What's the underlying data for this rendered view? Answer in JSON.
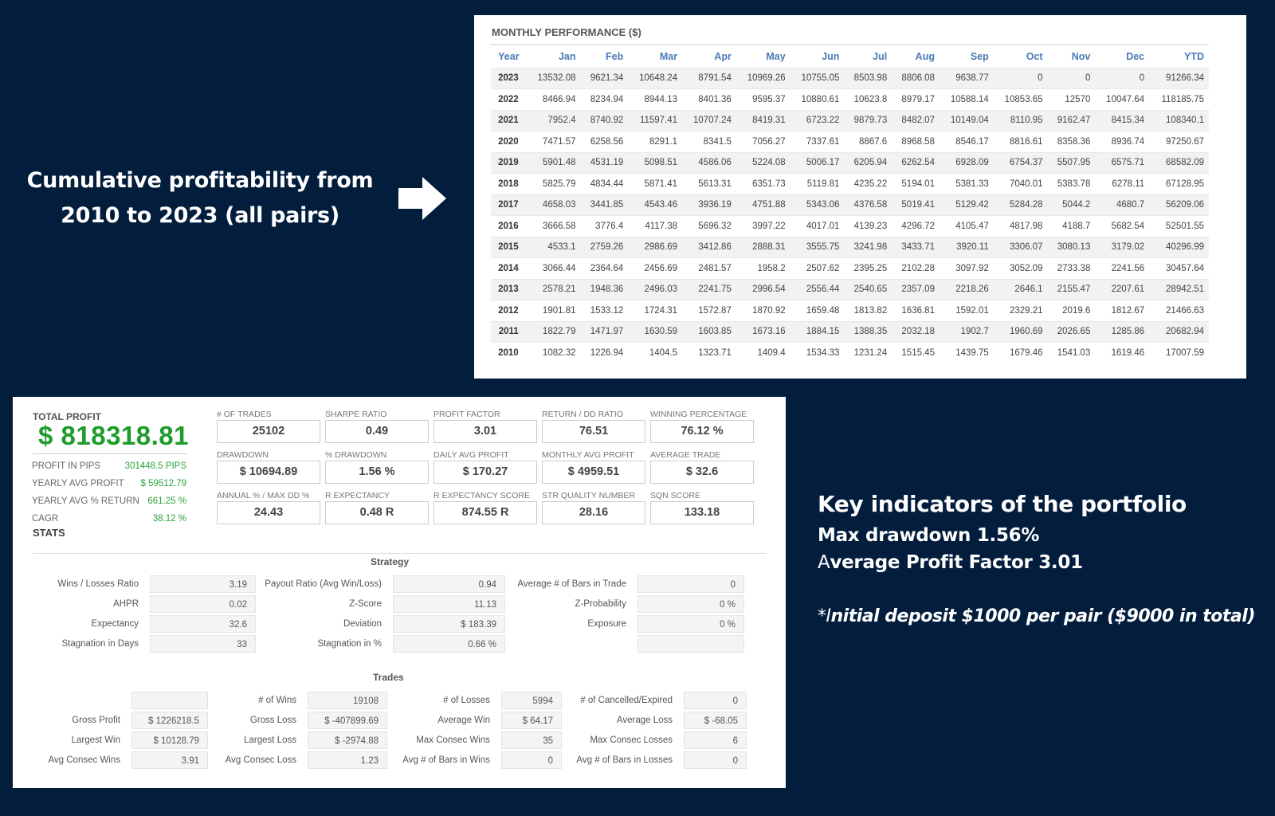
{
  "caption": {
    "line1": "Cumulative profitability from",
    "line2": "2010 to 2023 (all pairs)",
    "arrow_icon": "right-arrow-icon"
  },
  "monthly_performance": {
    "title": "MONTHLY PERFORMANCE ($)",
    "columns": [
      "Year",
      "Jan",
      "Feb",
      "Mar",
      "Apr",
      "May",
      "Jun",
      "Jul",
      "Aug",
      "Sep",
      "Oct",
      "Nov",
      "Dec",
      "YTD"
    ],
    "rows": [
      [
        "2023",
        "13532.08",
        "9621.34",
        "10648.24",
        "8791.54",
        "10969.26",
        "10755.05",
        "8503.98",
        "8806.08",
        "9638.77",
        "0",
        "0",
        "0",
        "91266.34"
      ],
      [
        "2022",
        "8466.94",
        "8234.94",
        "8944.13",
        "8401.36",
        "9595.37",
        "10880.61",
        "10623.8",
        "8979.17",
        "10588.14",
        "10853.65",
        "12570",
        "10047.64",
        "118185.75"
      ],
      [
        "2021",
        "7952.4",
        "8740.92",
        "11597.41",
        "10707.24",
        "8419.31",
        "6723.22",
        "9879.73",
        "8482.07",
        "10149.04",
        "8110.95",
        "9162.47",
        "8415.34",
        "108340.1"
      ],
      [
        "2020",
        "7471.57",
        "6258.56",
        "8291.1",
        "8341.5",
        "7056.27",
        "7337.61",
        "8867.6",
        "8968.58",
        "8546.17",
        "8816.61",
        "8358.36",
        "8936.74",
        "97250.67"
      ],
      [
        "2019",
        "5901.48",
        "4531.19",
        "5098.51",
        "4586.06",
        "5224.08",
        "5006.17",
        "6205.94",
        "6262.54",
        "6928.09",
        "6754.37",
        "5507.95",
        "6575.71",
        "68582.09"
      ],
      [
        "2018",
        "5825.79",
        "4834.44",
        "5871.41",
        "5613.31",
        "6351.73",
        "5119.81",
        "4235.22",
        "5194.01",
        "5381.33",
        "7040.01",
        "5383.78",
        "6278.11",
        "67128.95"
      ],
      [
        "2017",
        "4658.03",
        "3441.85",
        "4543.46",
        "3936.19",
        "4751.88",
        "5343.06",
        "4376.58",
        "5019.41",
        "5129.42",
        "5284.28",
        "5044.2",
        "4680.7",
        "56209.06"
      ],
      [
        "2016",
        "3666.58",
        "3776.4",
        "4117.38",
        "5696.32",
        "3997.22",
        "4017.01",
        "4139.23",
        "4296.72",
        "4105.47",
        "4817.98",
        "4188.7",
        "5682.54",
        "52501.55"
      ],
      [
        "2015",
        "4533.1",
        "2759.26",
        "2986.69",
        "3412.86",
        "2888.31",
        "3555.75",
        "3241.98",
        "3433.71",
        "3920.11",
        "3306.07",
        "3080.13",
        "3179.02",
        "40296.99"
      ],
      [
        "2014",
        "3066.44",
        "2364.64",
        "2456.69",
        "2481.57",
        "1958.2",
        "2507.62",
        "2395.25",
        "2102.28",
        "3097.92",
        "3052.09",
        "2733.38",
        "2241.56",
        "30457.64"
      ],
      [
        "2013",
        "2578.21",
        "1948.36",
        "2496.03",
        "2241.75",
        "2996.54",
        "2556.44",
        "2540.65",
        "2357.09",
        "2218.26",
        "2646.1",
        "2155.47",
        "2207.61",
        "28942.51"
      ],
      [
        "2012",
        "1901.81",
        "1533.12",
        "1724.31",
        "1572.87",
        "1870.92",
        "1659.48",
        "1813.82",
        "1636.81",
        "1592.01",
        "2329.21",
        "2019.6",
        "1812.67",
        "21466.63"
      ],
      [
        "2011",
        "1822.79",
        "1471.97",
        "1630.59",
        "1603.85",
        "1673.16",
        "1884.15",
        "1388.35",
        "2032.18",
        "1902.7",
        "1960.69",
        "2026.65",
        "1285.86",
        "20682.94"
      ],
      [
        "2010",
        "1082.32",
        "1226.94",
        "1404.5",
        "1323.71",
        "1409.4",
        "1534.33",
        "1231.24",
        "1515.45",
        "1439.75",
        "1679.46",
        "1541.03",
        "1619.46",
        "17007.59"
      ]
    ]
  },
  "summary": {
    "total_profit_label": "TOTAL PROFIT",
    "total_profit_value": "$ 818318.81",
    "rows": [
      {
        "label": "PROFIT IN PIPS",
        "value": "301448.5 PIPS"
      },
      {
        "label": "YEARLY AVG PROFIT",
        "value": "$ 59512.79"
      },
      {
        "label": "YEARLY AVG % RETURN",
        "value": "661.25 %"
      },
      {
        "label": "CAGR",
        "value": "38.12 %"
      }
    ],
    "kpis": [
      {
        "label": "# OF TRADES",
        "value": "25102"
      },
      {
        "label": "SHARPE RATIO",
        "value": "0.49"
      },
      {
        "label": "PROFIT FACTOR",
        "value": "3.01"
      },
      {
        "label": "RETURN / DD RATIO",
        "value": "76.51"
      },
      {
        "label": "WINNING PERCENTAGE",
        "value": "76.12 %"
      },
      {
        "label": "DRAWDOWN",
        "value": "$ 10694.89"
      },
      {
        "label": "% DRAWDOWN",
        "value": "1.56 %"
      },
      {
        "label": "DAILY AVG PROFIT",
        "value": "$ 170.27"
      },
      {
        "label": "MONTHLY AVG PROFIT",
        "value": "$ 4959.51"
      },
      {
        "label": "AVERAGE TRADE",
        "value": "$ 32.6"
      },
      {
        "label": "ANNUAL % / MAX DD %",
        "value": "24.43"
      },
      {
        "label": "R EXPECTANCY",
        "value": "0.48 R"
      },
      {
        "label": "R EXPECTANCY SCORE",
        "value": "874.55 R"
      },
      {
        "label": "STR QUALITY NUMBER",
        "value": "28.16"
      },
      {
        "label": "SQN SCORE",
        "value": "133.18"
      }
    ]
  },
  "stats": {
    "title": "STATS",
    "strategy": {
      "title": "Strategy",
      "rows": [
        [
          {
            "label": "Wins / Losses Ratio",
            "value": "3.19"
          },
          {
            "label": "Payout Ratio (Avg Win/Loss)",
            "value": "0.94"
          },
          {
            "label": "Average # of Bars in Trade",
            "value": "0"
          }
        ],
        [
          {
            "label": "AHPR",
            "value": "0.02"
          },
          {
            "label": "Z-Score",
            "value": "11.13"
          },
          {
            "label": "Z-Probability",
            "value": "0 %"
          }
        ],
        [
          {
            "label": "Expectancy",
            "value": "32.6"
          },
          {
            "label": "Deviation",
            "value": "$ 183.39"
          },
          {
            "label": "Exposure",
            "value": "0 %"
          }
        ],
        [
          {
            "label": "Stagnation in Days",
            "value": "33"
          },
          {
            "label": "Stagnation in %",
            "value": "0.66 %"
          },
          {
            "label": "",
            "value": ""
          }
        ]
      ]
    },
    "trades": {
      "title": "Trades",
      "rows": [
        [
          {
            "label": "",
            "value": ""
          },
          {
            "label": "# of Wins",
            "value": "19108"
          },
          {
            "label": "# of Losses",
            "value": "5994"
          },
          {
            "label": "# of Cancelled/Expired",
            "value": "0"
          }
        ],
        [
          {
            "label": "Gross Profit",
            "value": "$ 1226218.5"
          },
          {
            "label": "Gross Loss",
            "value": "$ -407899.69"
          },
          {
            "label": "Average Win",
            "value": "$ 64.17"
          },
          {
            "label": "Average Loss",
            "value": "$ -68.05"
          }
        ],
        [
          {
            "label": "Largest Win",
            "value": "$ 10128.79"
          },
          {
            "label": "Largest Loss",
            "value": "$ -2974.88"
          },
          {
            "label": "Max Consec Wins",
            "value": "35"
          },
          {
            "label": "Max Consec Losses",
            "value": "6"
          }
        ],
        [
          {
            "label": "Avg Consec Wins",
            "value": "3.91"
          },
          {
            "label": "Avg Consec Loss",
            "value": "1.23"
          },
          {
            "label": "Avg # of Bars in Wins",
            "value": "0"
          },
          {
            "label": "Avg # of Bars in Losses",
            "value": "0"
          }
        ]
      ]
    }
  },
  "notes": {
    "heading": "Key indicators of the portfolio",
    "line1": "Max drawdown 1.56%",
    "line2_first": "A",
    "line2_rest": "verage Profit Factor 3.01",
    "footnote_star": "*I",
    "footnote_rest": "nitial deposit $1000 per pair ($9000 in total)"
  }
}
